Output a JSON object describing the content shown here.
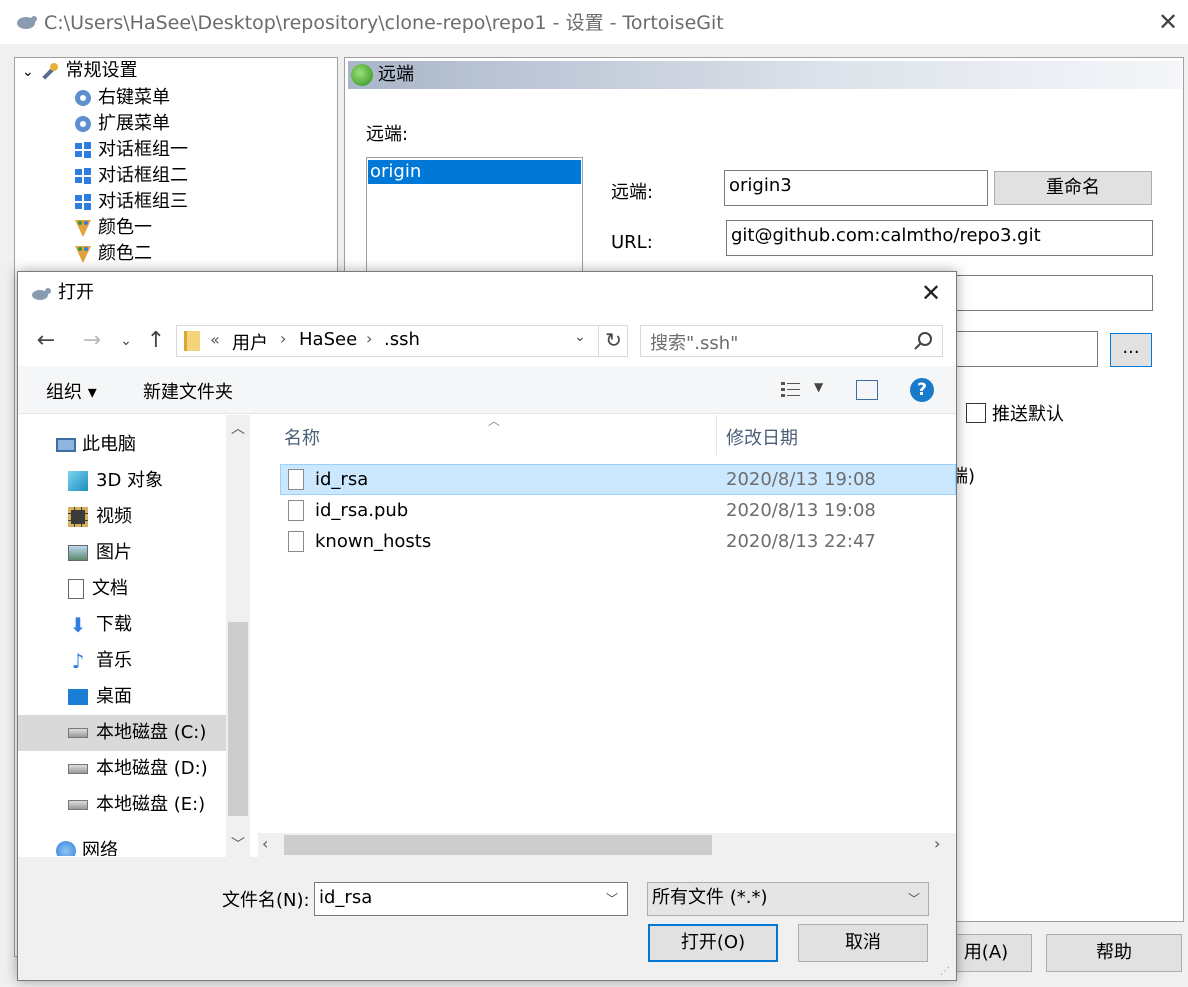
{
  "main_window": {
    "title": "C:\\Users\\HaSee\\Desktop\\repository\\clone-repo\\repo1 - 设置 - TortoiseGit",
    "tree": [
      {
        "label": "常规设置",
        "icon": "wrench-icon"
      },
      {
        "label": "右键菜单",
        "icon": "gear-icon"
      },
      {
        "label": "扩展菜单",
        "icon": "gear-icon"
      },
      {
        "label": "对话框组一",
        "icon": "windows-icon"
      },
      {
        "label": "对话框组二",
        "icon": "windows-icon"
      },
      {
        "label": "对话框组三",
        "icon": "windows-icon"
      },
      {
        "label": "颜色一",
        "icon": "palette-icon"
      },
      {
        "label": "颜色二",
        "icon": "palette-icon"
      }
    ],
    "page_title": "远端",
    "remote_list_label": "远端:",
    "remote_list": [
      "origin"
    ],
    "remote_label": "远端:",
    "remote_value": "origin3",
    "rename_button": "重命名",
    "url_label": "URL:",
    "url_value": "git@github.com:calmtho/repo3.git",
    "browse_button": "...",
    "push_default_label": "推送默认",
    "obscured_tail": "端)",
    "apply_button": "用(A)",
    "help_button": "帮助"
  },
  "dialog": {
    "title": "打开",
    "address": {
      "chevrons": "«",
      "crumbs": [
        "用户",
        "HaSee",
        ".ssh"
      ]
    },
    "search_placeholder": "搜索\".ssh\"",
    "organize": "组织 ▾",
    "new_folder": "新建文件夹",
    "help": "?",
    "nav": [
      {
        "label": "此电脑",
        "icon": "computer-icon"
      },
      {
        "label": "3D 对象",
        "icon": "cube-icon"
      },
      {
        "label": "视频",
        "icon": "video-icon"
      },
      {
        "label": "图片",
        "icon": "picture-icon"
      },
      {
        "label": "文档",
        "icon": "document-icon"
      },
      {
        "label": "下载",
        "icon": "download-icon"
      },
      {
        "label": "音乐",
        "icon": "music-icon"
      },
      {
        "label": "桌面",
        "icon": "desktop-icon"
      },
      {
        "label": "本地磁盘 (C:)",
        "icon": "drive-icon"
      },
      {
        "label": "本地磁盘 (D:)",
        "icon": "drive-icon"
      },
      {
        "label": "本地磁盘 (E:)",
        "icon": "drive-icon"
      },
      {
        "label": "网络",
        "icon": "network-icon"
      }
    ],
    "columns": {
      "name": "名称",
      "date": "修改日期"
    },
    "files": [
      {
        "name": "id_rsa",
        "date": "2020/8/13 19:08",
        "selected": true
      },
      {
        "name": "id_rsa.pub",
        "date": "2020/8/13 19:08",
        "selected": false
      },
      {
        "name": "known_hosts",
        "date": "2020/8/13 22:47",
        "selected": false
      }
    ],
    "filename_label": "文件名(N):",
    "filename_value": "id_rsa",
    "filter_value": "所有文件 (*.*)",
    "open_button": "打开(O)",
    "cancel_button": "取消"
  }
}
